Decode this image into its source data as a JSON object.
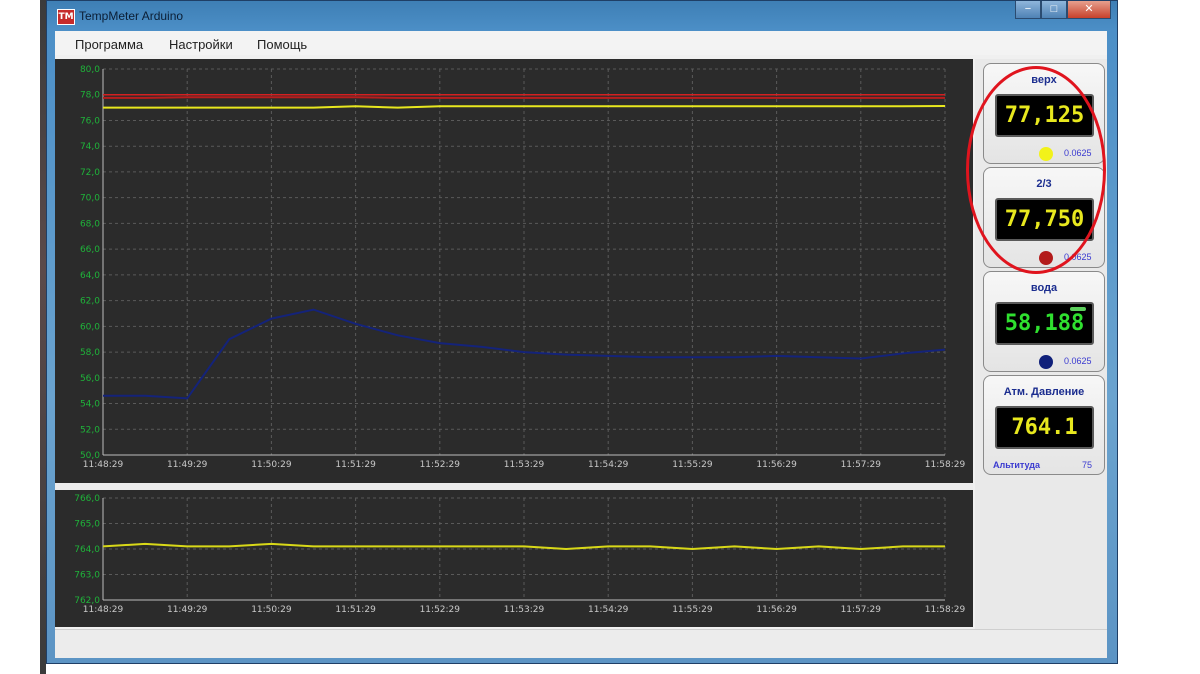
{
  "window": {
    "title": "TempMeter Arduino",
    "icon_label": "TM",
    "controls": {
      "minimize": "−",
      "maximize": "□",
      "close": "✕"
    }
  },
  "menu": {
    "items": [
      "Программа",
      "Настройки",
      "Помощь"
    ]
  },
  "colors": {
    "chart_bg": "#2b2b2b",
    "grid": "#5a5a5a",
    "axis_text": "#1fb33a",
    "time_text": "#c9c9c9",
    "series_top": "#e8e81e",
    "series_mid": "#b81c1c",
    "series_water": "#14237a",
    "pressure": "#d8d818",
    "highlight": "#e0141e"
  },
  "sensors": [
    {
      "title": "верх",
      "value": "77,125",
      "value_color": "#e8e81e",
      "dot_color": "#f2f21a",
      "resolution": "0.0625"
    },
    {
      "title": "2/3",
      "value": "77,750",
      "value_color": "#e8e81e",
      "dot_color": "#b31b1b",
      "resolution": "0.0625"
    },
    {
      "title": "вода",
      "value": "58,188",
      "value_color": "#2fe02f",
      "dot_color": "#10207a",
      "resolution": "0.0625"
    }
  ],
  "pressure_card": {
    "title": "Атм. Давление",
    "value": "764.1",
    "altitude_label": "Альтитуда",
    "altitude_value": "75"
  },
  "chart_data": [
    {
      "type": "line",
      "title": "",
      "ylim": [
        50,
        80
      ],
      "y_ticks": [
        "80,0",
        "78,0",
        "76,0",
        "74,0",
        "72,0",
        "70,0",
        "68,0",
        "66,0",
        "64,0",
        "62,0",
        "60,0",
        "58,0",
        "56,0",
        "54,0",
        "52,0",
        "50,0"
      ],
      "x_ticks": [
        "11:48:29",
        "11:49:29",
        "11:50:29",
        "11:51:29",
        "11:52:29",
        "11:53:29",
        "11:54:29",
        "11:55:29",
        "11:56:29",
        "11:57:29",
        "11:58:29"
      ],
      "threshold": 78.0,
      "series": [
        {
          "name": "верх",
          "color": "#e8e81e",
          "values": [
            77.0,
            77.0,
            77.0,
            77.0,
            77.0,
            77.0,
            77.1,
            77.0,
            77.1,
            77.1,
            77.1,
            77.1,
            77.1,
            77.1,
            77.1,
            77.1,
            77.1,
            77.1,
            77.1,
            77.1,
            77.125
          ]
        },
        {
          "name": "2/3",
          "color": "#b81c1c",
          "values": [
            77.75,
            77.75,
            77.8,
            77.8,
            77.8,
            77.8,
            77.8,
            77.75,
            77.75,
            77.75,
            77.75,
            77.75,
            77.75,
            77.75,
            77.75,
            77.75,
            77.75,
            77.75,
            77.75,
            77.75,
            77.75
          ]
        },
        {
          "name": "вода",
          "color": "#14237a",
          "values": [
            54.6,
            54.6,
            54.4,
            59.0,
            60.6,
            61.3,
            60.2,
            59.3,
            58.7,
            58.4,
            58.0,
            57.8,
            57.7,
            57.6,
            57.6,
            57.6,
            57.7,
            57.6,
            57.5,
            57.9,
            58.188
          ]
        }
      ]
    },
    {
      "type": "line",
      "title": "",
      "ylim": [
        762,
        766
      ],
      "y_ticks": [
        "766,0",
        "765,0",
        "764,0",
        "763,0",
        "762,0"
      ],
      "x_ticks": [
        "11:48:29",
        "11:49:29",
        "11:50:29",
        "11:51:29",
        "11:52:29",
        "11:53:29",
        "11:54:29",
        "11:55:29",
        "11:56:29",
        "11:57:29",
        "11:58:29"
      ],
      "series": [
        {
          "name": "Атм. Давление",
          "color": "#d8d818",
          "values": [
            764.1,
            764.2,
            764.1,
            764.1,
            764.2,
            764.1,
            764.1,
            764.1,
            764.1,
            764.1,
            764.1,
            764.0,
            764.1,
            764.1,
            764.0,
            764.1,
            764.0,
            764.1,
            764.0,
            764.1,
            764.1
          ]
        }
      ]
    }
  ]
}
